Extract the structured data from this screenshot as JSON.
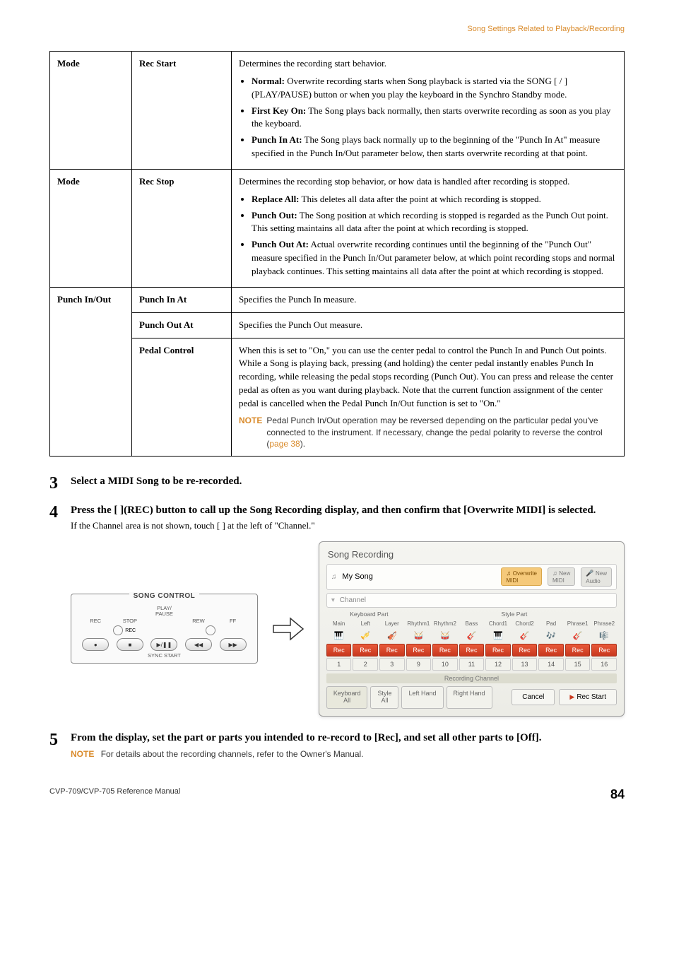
{
  "breadcrumb": "Song Settings Related to Playback/Recording",
  "table": {
    "rows": [
      {
        "mode": "Mode",
        "param": "Rec Start",
        "desc_intro": "Determines the recording start behavior.",
        "items": [
          {
            "label": "Normal:",
            "text": " Overwrite recording starts when Song playback is started via the SONG [   /   ] (PLAY/PAUSE) button or when you play the keyboard in the Synchro Standby mode."
          },
          {
            "label": "First Key On:",
            "text": " The Song plays back normally, then starts overwrite recording as soon as you play the keyboard."
          },
          {
            "label": "Punch In At:",
            "text": " The Song plays back normally up to the beginning of the \"Punch In At\" measure specified in the Punch In/Out parameter below, then starts overwrite recording at that point."
          }
        ]
      },
      {
        "mode": "Mode",
        "param": "Rec Stop",
        "desc_intro": "Determines the recording stop behavior, or how data is handled after recording is stopped.",
        "items": [
          {
            "label": "Replace All:",
            "text": " This deletes all data after the point at which recording is stopped."
          },
          {
            "label": "Punch Out:",
            "text": " The Song position at which recording is stopped is regarded as the Punch Out point. This setting maintains all data after the point at which recording is stopped."
          },
          {
            "label": "Punch Out At:",
            "text": " Actual overwrite recording continues until the beginning of the \"Punch Out\" measure specified in the Punch In/Out parameter below, at which point recording stops and normal playback continues. This setting maintains all data after the point at which recording is stopped."
          }
        ]
      },
      {
        "mode": "Punch In/Out",
        "param": "Punch In At",
        "desc_plain": "Specifies the Punch In measure."
      },
      {
        "param": "Punch Out At",
        "desc_plain": "Specifies the Punch Out measure."
      },
      {
        "param": "Pedal Control",
        "desc_plain": "When this is set to \"On,\" you can use the center pedal to control the Punch In and Punch Out points. While a Song is playing back, pressing (and holding) the center pedal instantly enables Punch In recording, while releasing the pedal stops recording (Punch Out). You can press and release the center pedal as often as you want during playback. Note that the current function assignment of the center pedal is cancelled when the Pedal Punch In/Out function is set to \"On.\"",
        "note": "Pedal Punch In/Out operation may be reversed depending on the particular pedal you've connected to the instrument. If necessary, change the pedal polarity to reverse the control (",
        "note_link": "page 38",
        "note_end": ")."
      }
    ]
  },
  "steps": {
    "s3": {
      "num": "3",
      "head": "Select a MIDI Song to be re-recorded."
    },
    "s4": {
      "num": "4",
      "head": "Press the [   ](REC) button to call up the Song Recording display, and then confirm that [Overwrite MIDI] is selected.",
      "sub": "If the Channel area is not shown, touch [   ] at the left of \"Channel.\""
    },
    "s5": {
      "num": "5",
      "head": "From the display, set the part or parts you intended to re-record to [Rec], and set all other parts to [Off].",
      "note": "For details about the recording channels, refer to the Owner's Manual."
    }
  },
  "panel": {
    "title": "SONG CONTROL",
    "labels": [
      "REC",
      "STOP",
      "PLAY/\nPAUSE",
      "REW",
      "FF"
    ],
    "sync": "SYNC START"
  },
  "screen": {
    "title": "Song Recording",
    "song_name": "My Song",
    "pill_overwrite": "Overwrite\nMIDI",
    "pill_new_midi": "New\nMIDI",
    "pill_new_audio": "New\nAudio",
    "channel": "Channel",
    "kbp": "Keyboard Part",
    "stp": "Style Part",
    "part_labels": [
      "Main",
      "Left",
      "Layer",
      "Rhythm1",
      "Rhythm2",
      "Bass",
      "Chord1",
      "Chord2",
      "Pad",
      "Phrase1",
      "Phrase2"
    ],
    "rec": "Rec",
    "channels": [
      "1",
      "2",
      "3",
      "9",
      "10",
      "11",
      "12",
      "13",
      "14",
      "15",
      "16"
    ],
    "rec_channel": "Recording Channel",
    "tabs": [
      "Keyboard\nAll",
      "Style\nAll",
      "Left Hand",
      "Right Hand"
    ],
    "cancel": "Cancel",
    "rec_start": "Rec Start"
  },
  "notes": {
    "label": "NOTE"
  },
  "footer": {
    "ref": "CVP-709/CVP-705 Reference Manual",
    "page": "84"
  }
}
